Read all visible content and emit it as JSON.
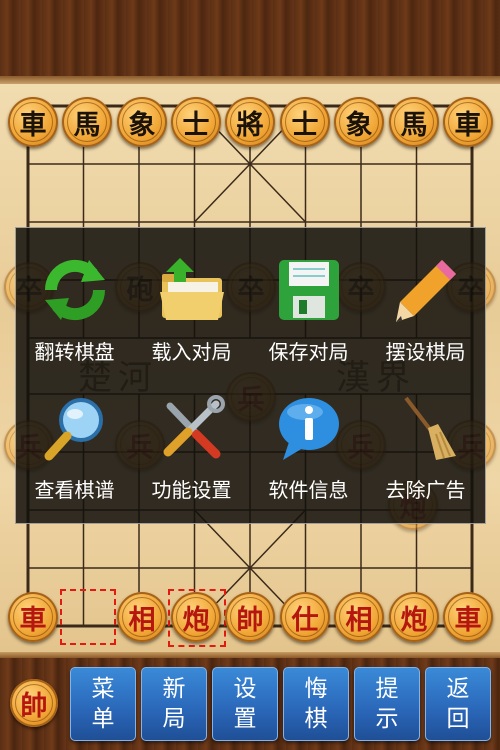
{
  "top_row": [
    "車",
    "馬",
    "象",
    "士",
    "將",
    "士",
    "象",
    "馬",
    "車"
  ],
  "bottom_row": [
    "車",
    "",
    "相",
    "炮",
    "帥",
    "仕",
    "相",
    "炮",
    "車"
  ],
  "soldier_black": "卒",
  "soldier_red": "兵",
  "cannon_black": "砲",
  "cannon_red": "炮",
  "river": {
    "left": "楚河",
    "right": "漢界"
  },
  "menu": {
    "items": [
      {
        "label": "翻转棋盘",
        "icon": "rotate-arrows-icon"
      },
      {
        "label": "载入对局",
        "icon": "folder-upload-icon"
      },
      {
        "label": "保存对局",
        "icon": "floppy-disk-icon"
      },
      {
        "label": "摆设棋局",
        "icon": "pencil-icon"
      },
      {
        "label": "查看棋谱",
        "icon": "magnifier-icon"
      },
      {
        "label": "功能设置",
        "icon": "tools-icon"
      },
      {
        "label": "软件信息",
        "icon": "info-bubble-icon"
      },
      {
        "label": "去除广告",
        "icon": "broom-icon"
      }
    ]
  },
  "toolbar": {
    "side_piece": "帥",
    "buttons": [
      {
        "top": "菜",
        "bottom": "单"
      },
      {
        "top": "新",
        "bottom": "局"
      },
      {
        "top": "设",
        "bottom": "置"
      },
      {
        "top": "悔",
        "bottom": "棋"
      },
      {
        "top": "提",
        "bottom": "示"
      },
      {
        "top": "返",
        "bottom": "回"
      }
    ]
  },
  "colors": {
    "menu_bg": "#120f0c",
    "button": "#2a66b8",
    "red_piece_text": "#b5170f",
    "selection": "#e21a0f"
  }
}
